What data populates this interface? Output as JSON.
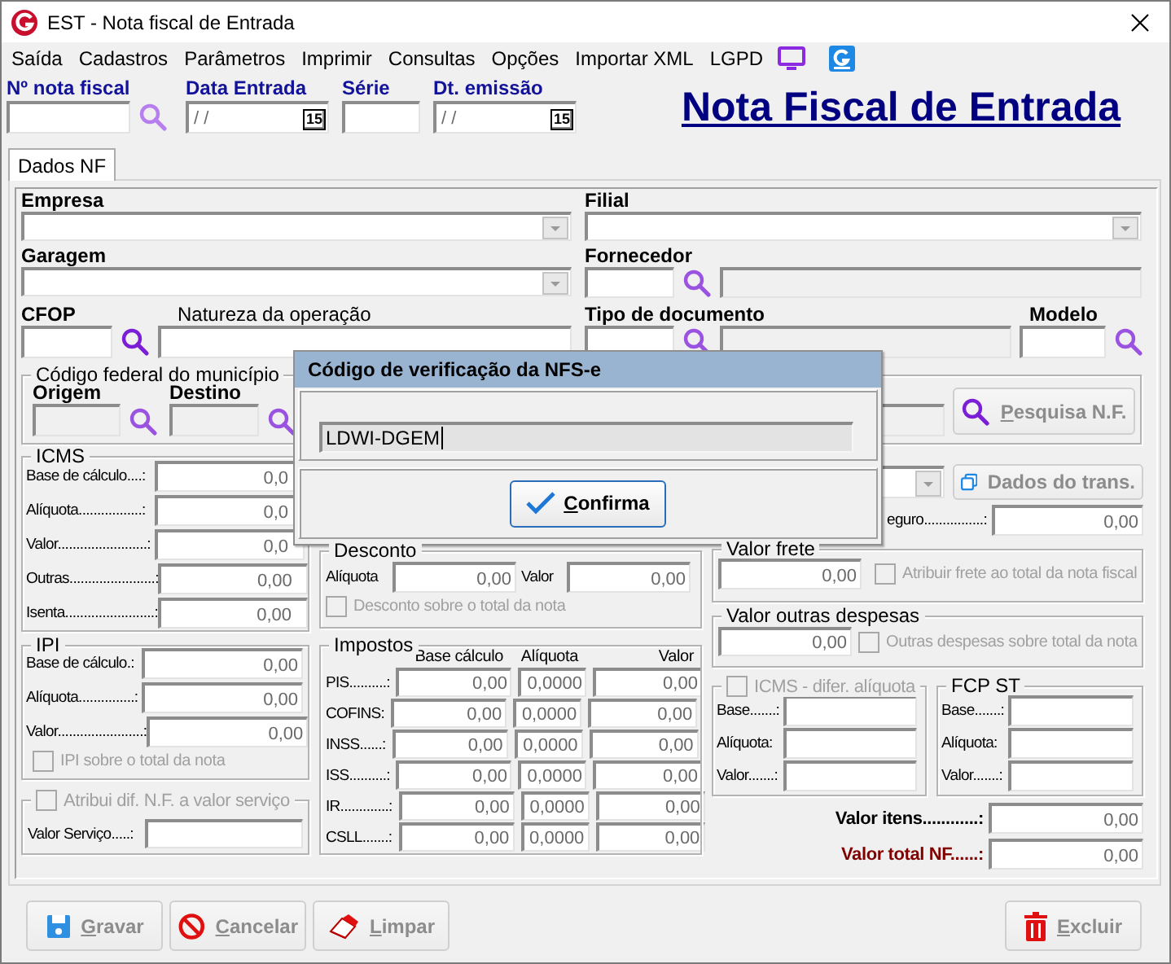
{
  "window": {
    "title": "EST - Nota fiscal de Entrada"
  },
  "menu": [
    "Saída",
    "Cadastros",
    "Parâmetros",
    "Imprimir",
    "Consultas",
    "Opções",
    "Importar XML",
    "LGPD"
  ],
  "header": {
    "fields": [
      {
        "label": "Nº nota fiscal",
        "kind": "search"
      },
      {
        "label": "Data Entrada",
        "kind": "date",
        "value": "/ /",
        "calendar": "15"
      },
      {
        "label": "Série",
        "kind": "text"
      },
      {
        "label": "Dt. emissão",
        "kind": "date",
        "value": "/ /",
        "calendar": "15"
      }
    ],
    "title": "Nota Fiscal de Entrada"
  },
  "tabs": [
    {
      "label": "Dados NF",
      "selected": true
    }
  ],
  "form": {
    "empresa": "Empresa",
    "filial": "Filial",
    "garagem": "Garagem",
    "fornecedor": "Fornecedor",
    "cfop": "CFOP",
    "natureza": "Natureza da operação",
    "tipo_documento": "Tipo de documento",
    "modelo": "Modelo"
  },
  "municipio": {
    "title": "Código federal do município",
    "origem": "Origem",
    "destino": "Destino",
    "button": "Pesquisa N.F."
  },
  "icms": {
    "title": "ICMS",
    "rows": [
      {
        "label": "Base de cálculo....:",
        "value": "0,0"
      },
      {
        "label": "Alíquota.................:",
        "value": "0,0"
      },
      {
        "label": "Valor........................:",
        "value": "0,0"
      },
      {
        "label": "Outras.......................:",
        "value": "0,00"
      },
      {
        "label": "Isenta........................:",
        "value": "0,00"
      }
    ]
  },
  "ipi": {
    "title": "IPI",
    "rows": [
      {
        "label": "Base de cálculo.:",
        "value": "0,00"
      },
      {
        "label": "Alíquota...............:",
        "value": "0,00"
      },
      {
        "label": "Valor.......................:",
        "value": "0,00"
      }
    ],
    "checkbox": {
      "label": "IPI sobre o total da nota",
      "checked": false,
      "disabled": true
    }
  },
  "servico": {
    "title": "Atribui dif. N.F. a valor serviço",
    "checked": false,
    "disabled": true,
    "label": "Valor Serviço.....:"
  },
  "desconto": {
    "title": "Desconto",
    "aliquota_label": "Alíquota",
    "aliquota": "0,00",
    "valor_label": "Valor",
    "valor": "0,00",
    "checkbox": {
      "label": "Desconto sobre o total da nota",
      "checked": false,
      "disabled": true
    }
  },
  "impostos": {
    "title": "Impostos",
    "columns": [
      "Base cálculo",
      "Alíquota",
      "Valor"
    ],
    "rows": [
      {
        "label": "PIS..........:",
        "base": "0,00",
        "aliquota": "0,0000",
        "valor": "0,00"
      },
      {
        "label": "COFINS:",
        "base": "0,00",
        "aliquota": "0,0000",
        "valor": "0,00"
      },
      {
        "label": "INSS......:",
        "base": "0,00",
        "aliquota": "0,0000",
        "valor": "0,00"
      },
      {
        "label": "ISS..........:",
        "base": "0,00",
        "aliquota": "0,0000",
        "valor": "0,00"
      },
      {
        "label": "IR.............:",
        "base": "0,00",
        "aliquota": "0,0000",
        "valor": "0,00"
      },
      {
        "label": "CSLL.......:",
        "base": "0,00",
        "aliquota": "0,0000",
        "valor": "0,00"
      }
    ]
  },
  "transporte": {
    "button": "Dados do trans.",
    "seguro_label": "eguro................:",
    "seguro": "0,00"
  },
  "frete": {
    "title": "Valor frete",
    "value": "0,00",
    "checkbox": {
      "label": "Atribuir frete ao total da nota fiscal",
      "checked": false,
      "disabled": true
    }
  },
  "outras": {
    "title": "Valor outras despesas",
    "value": "0,00",
    "checkbox": {
      "label": "Outras despesas sobre total da nota",
      "checked": false,
      "disabled": true
    }
  },
  "difer": {
    "title": "ICMS - difer. alíquota",
    "checked": false,
    "disabled": true,
    "rows": [
      "Base.......:",
      "Alíquota:",
      "Valor.......:"
    ]
  },
  "fcp": {
    "title": "FCP ST",
    "rows": [
      "Base.......:",
      "Alíquota:",
      "Valor.......:"
    ]
  },
  "totals": [
    {
      "label": "Valor itens............:",
      "value": "0,00",
      "kind": "itens"
    },
    {
      "label": "Valor total NF......:",
      "value": "0,00",
      "kind": "total"
    }
  ],
  "buttons": [
    {
      "label": "Gravar",
      "kind": "save",
      "disabled": true
    },
    {
      "label": "Cancelar",
      "kind": "cancel",
      "disabled": true
    },
    {
      "label": "Limpar",
      "kind": "clear",
      "disabled": true
    },
    {
      "label": "Excluir",
      "kind": "delete",
      "disabled": true
    }
  ],
  "dialog": {
    "title": "Código de verificação da NFS-e",
    "value": "LDWI-DGEM",
    "button": "Confirma"
  }
}
